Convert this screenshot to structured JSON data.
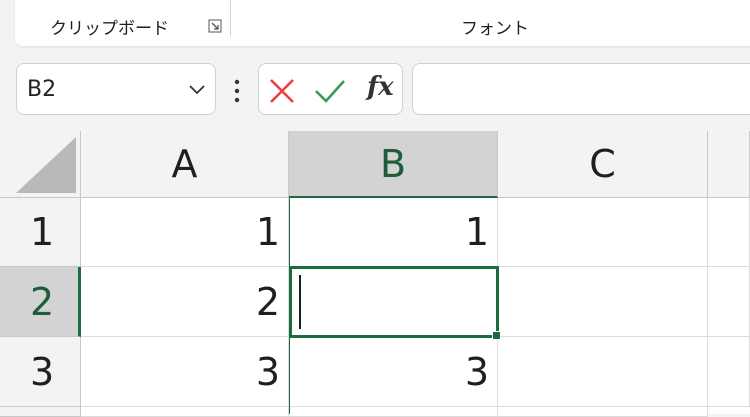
{
  "ribbon": {
    "clipboard_label": "クリップボード",
    "font_label": "フォント",
    "clipboard_launcher_icon": "dialog-launcher-icon"
  },
  "formula_bar": {
    "name_box": "B2",
    "formula_value": "",
    "cancel_icon": "x-icon",
    "enter_icon": "check-icon",
    "fx_label": "fx",
    "cancel_color": "#e8413e",
    "enter_color": "#3a9b54"
  },
  "grid": {
    "columns": [
      "A",
      "B",
      "C"
    ],
    "rows": [
      "1",
      "2",
      "3"
    ],
    "selected_column": "B",
    "selected_row": "2",
    "cells": [
      {
        "A": "1",
        "B": "1",
        "C": ""
      },
      {
        "A": "2",
        "B": "",
        "C": ""
      },
      {
        "A": "3",
        "B": "3",
        "C": ""
      }
    ],
    "accent_color": "#1e6b41"
  }
}
